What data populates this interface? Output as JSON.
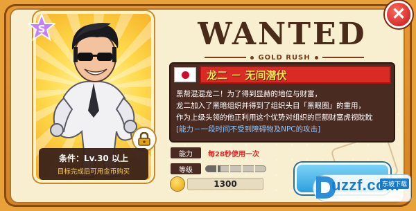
{
  "header": {
    "title": "WANTED",
    "subtitle": "GOLD RUSH"
  },
  "close_button": {
    "icon": "close-icon",
    "glyph": "✕"
  },
  "character": {
    "rarity": "S",
    "name": "龙二 － 无间潜伏",
    "flag": "japan-flag-icon",
    "description_lines": [
      "黑帮混混龙二！为了得到显赫的地位与财富，",
      "龙二加入了黑暗组织并得到了组织头目「黑眼圈」的重用，",
      "作为上级头领的他正利用这个优势对组织的巨额财富虎视眈眈"
    ],
    "ability_line": "[能力－一段时间不受到障碍物及NPC的攻击]"
  },
  "unlock": {
    "condition": "条件：Lv.30 以上",
    "hint": "目标完成后可用金币购买",
    "icon": "lock-icon"
  },
  "stats": {
    "ability_label": "能力",
    "ability_value": "每28秒使用一次",
    "level_label": "等级",
    "level_progress": 0.25,
    "price": "1300",
    "price_icon": "stopwatch-coin-icon"
  },
  "watermark": {
    "logo": "uzzf.com",
    "tag": "东坡下载"
  },
  "colors": {
    "frame": "#e89a2f",
    "card": "#f8efd0",
    "panel": "#4a2b22",
    "name_banner": "#d92a25",
    "name_text": "#ffe84a",
    "ability_text": "#8fc8ff",
    "buy_button": "#2d9fdc"
  }
}
